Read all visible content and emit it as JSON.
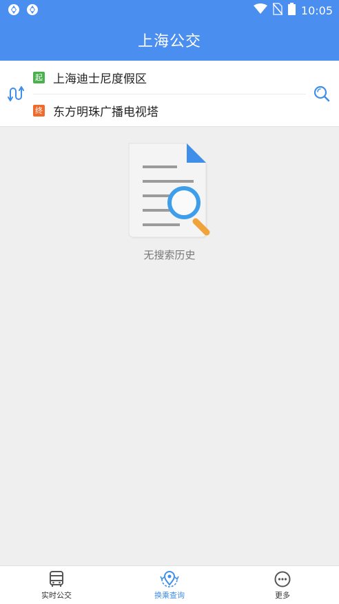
{
  "status_bar": {
    "time": "10:05",
    "left_icons": [
      "app-notification-icon",
      "app-notification-icon"
    ],
    "right_icons": [
      "wifi-icon",
      "no-sim-icon",
      "battery-icon"
    ]
  },
  "header": {
    "title": "上海公交"
  },
  "route": {
    "start_tag": "起",
    "start_name": "上海迪士尼度假区",
    "end_tag": "终",
    "end_name": "东方明珠广播电视塔"
  },
  "empty_state": {
    "message": "无搜索历史"
  },
  "bottom_nav": {
    "items": [
      {
        "label": "实时公交",
        "icon": "bus-icon",
        "active": false
      },
      {
        "label": "换乘查询",
        "icon": "transfer-location-icon",
        "active": true
      },
      {
        "label": "更多",
        "icon": "more-icon",
        "active": false
      }
    ]
  },
  "colors": {
    "primary": "#4a8ef0",
    "start_tag": "#4cb04f",
    "end_tag": "#f06a2c",
    "active_nav": "#3f8ee9",
    "background": "#efefef"
  }
}
